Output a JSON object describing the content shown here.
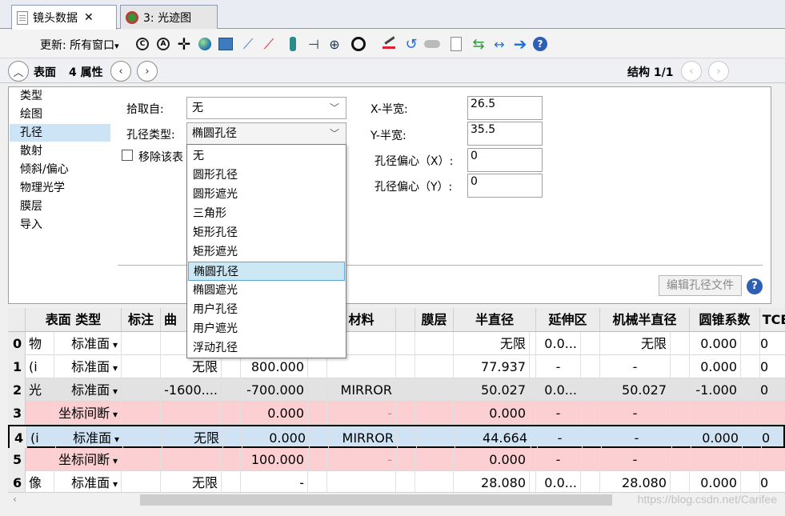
{
  "tabs": [
    {
      "label": "镜头数据",
      "close": "✕"
    },
    {
      "label": "3: 光迹图"
    }
  ],
  "toolbar": {
    "update_label": "更新: 所有窗口",
    "update_arrow": "▾"
  },
  "header": {
    "surface_label": "表面",
    "props_label": "4 属性",
    "config_label": "结构 1/1"
  },
  "categories": [
    "类型",
    "绘图",
    "孔径",
    "散射",
    "倾斜/偏心",
    "物理光学",
    "膜层",
    "导入"
  ],
  "form": {
    "pickup_label": "拾取自:",
    "pickup_value": "无",
    "aperture_type_label": "孔径类型:",
    "aperture_type_value": "椭圆孔径",
    "remove_label": "移除该表",
    "x_half_label": "X-半宽:",
    "x_half_value": "26.5",
    "y_half_label": "Y-半宽:",
    "y_half_value": "35.5",
    "decenter_x_label": "孔径偏心（X）:",
    "decenter_x_value": "0",
    "decenter_y_label": "孔径偏心（Y）:",
    "decenter_y_value": "0",
    "edit_button": "编辑孔径文件"
  },
  "dropdown_options": [
    "无",
    "圆形孔径",
    "圆形遮光",
    "三角形",
    "矩形孔径",
    "矩形遮光",
    "椭圆孔径",
    "椭圆遮光",
    "用户孔径",
    "用户遮光",
    "浮动孔径"
  ],
  "dropdown_selected": 6,
  "grid": {
    "headers": [
      "表面 类型",
      "标注",
      "曲",
      "材料",
      "膜层",
      "半直径",
      "延伸区",
      "机械半直径",
      "圆锥系数",
      "TCE"
    ],
    "rows": [
      {
        "n": "0",
        "tag": "物",
        "type": "标准面",
        "curv": "",
        "thick": "",
        "mat": "",
        "semi": "无限",
        "ext": "0.0...",
        "mech": "无限",
        "conic": "0.000",
        "tce": "0",
        "style": "white"
      },
      {
        "n": "1",
        "tag": "(i",
        "type": "标准面",
        "curv": "无限",
        "thick": "800.000",
        "mat": "",
        "semi": "77.937",
        "ext": "-",
        "mech": "-",
        "conic": "0.000",
        "tce": "0",
        "style": "white"
      },
      {
        "n": "2",
        "tag": "光",
        "type": "标准面",
        "curv": "-1600....",
        "thick": "-700.000",
        "mat": "MIRROR",
        "semi": "50.027",
        "ext": "0.0...",
        "mech": "50.027",
        "conic": "-1.000",
        "tce": "0",
        "style": "gray"
      },
      {
        "n": "3",
        "tag": "",
        "type": "坐标间断",
        "curv": "",
        "thick": "0.000",
        "mat": "-",
        "semi": "0.000",
        "ext": "-",
        "mech": "-",
        "conic": "",
        "tce": "",
        "style": "pink"
      },
      {
        "n": "4",
        "tag": "(i",
        "type": "标准面",
        "curv": "无限",
        "thick": "0.000",
        "mat": "MIRROR",
        "semi": "44.664",
        "ext": "-",
        "mech": "-",
        "conic": "0.000",
        "tce": "0",
        "style": "blue"
      },
      {
        "n": "5",
        "tag": "",
        "type": "坐标间断",
        "curv": "",
        "thick": "100.000",
        "mat": "-",
        "semi": "0.000",
        "ext": "-",
        "mech": "-",
        "conic": "",
        "tce": "",
        "style": "pink"
      },
      {
        "n": "6",
        "tag": "像",
        "type": "标准面",
        "curv": "无限",
        "thick": "-",
        "mat": "",
        "semi": "28.080",
        "ext": "0.0...",
        "mech": "28.080",
        "conic": "0.000",
        "tce": "0",
        "style": "white"
      }
    ]
  },
  "watermark": "https://blog.csdn.net/Carifee",
  "colors": {
    "accent": "#1e6fd9",
    "selected": "#cde3f6",
    "pink_row": "#fccfd3"
  }
}
